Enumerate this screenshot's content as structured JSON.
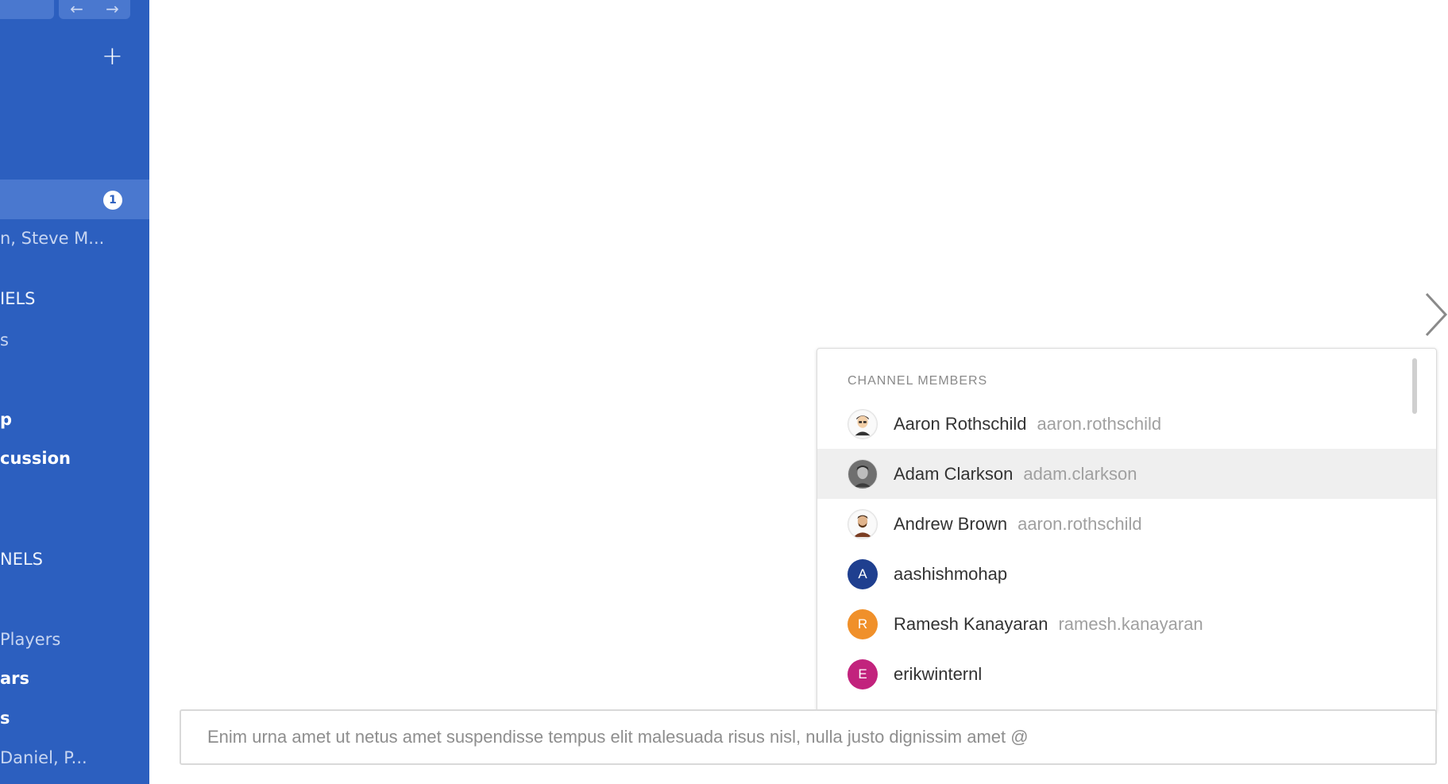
{
  "sidebar": {
    "active_badge": "1",
    "rows": [
      {
        "text": "n, Steve M...",
        "style": "muted"
      },
      {
        "text": "IELS",
        "style": "normal"
      },
      {
        "text": "s",
        "style": "muted"
      },
      {
        "text": "p",
        "style": "bold"
      },
      {
        "text": "cussion",
        "style": "bold"
      },
      {
        "text": "NELS",
        "style": "normal"
      },
      {
        "text": "Players",
        "style": "muted"
      },
      {
        "text": "ars",
        "style": "bold"
      },
      {
        "text": "s",
        "style": "bold"
      },
      {
        "text": "Daniel, P...",
        "style": "muted"
      }
    ]
  },
  "mentions": {
    "header": "CHANNEL MEMBERS",
    "members": [
      {
        "name": "Aaron Rothschild",
        "handle": "aaron.rothschild",
        "avatar": "photo",
        "selected": false
      },
      {
        "name": "Adam Clarkson",
        "handle": "adam.clarkson",
        "avatar": "photo",
        "selected": true
      },
      {
        "name": "Andrew Brown",
        "handle": "aaron.rothschild",
        "avatar": "photo",
        "selected": false
      },
      {
        "name": "aashishmohap",
        "handle": "",
        "avatar": "A",
        "avatar_color": "#1f3f8f",
        "selected": false
      },
      {
        "name": "Ramesh Kanayaran",
        "handle": "ramesh.kanayaran",
        "avatar": "R",
        "avatar_color": "#f0902a",
        "selected": false
      },
      {
        "name": "erikwinternl",
        "handle": "",
        "avatar": "E",
        "avatar_color": "#c2237d",
        "selected": false
      }
    ]
  },
  "composer": {
    "text": "Enim urna amet ut netus amet suspendisse tempus elit malesuada risus nisl, nulla justo dignissim amet @"
  }
}
